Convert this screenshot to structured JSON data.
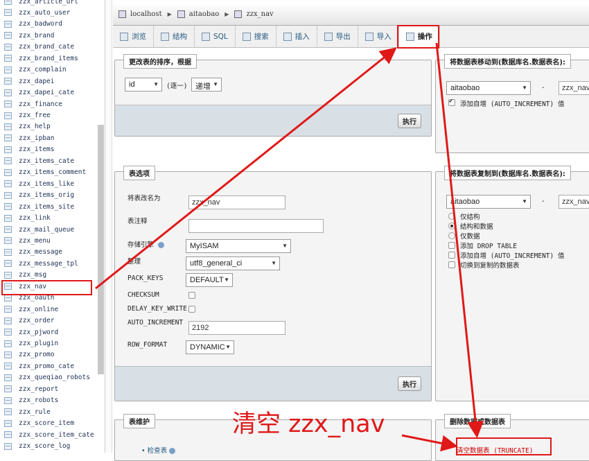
{
  "sidebar": {
    "tables": [
      "zzx_article_url",
      "zzx_auto_user",
      "zzx_badword",
      "zzx_brand",
      "zzx_brand_cate",
      "zzx_brand_items",
      "zzx_complain",
      "zzx_dapei",
      "zzx_dapei_cate",
      "zzx_finance",
      "zzx_free",
      "zzx_help",
      "zzx_ipban",
      "zzx_items",
      "zzx_items_cate",
      "zzx_items_comment",
      "zzx_items_like",
      "zzx_items_orig",
      "zzx_items_site",
      "zzx_link",
      "zzx_mail_queue",
      "zzx_menu",
      "zzx_message",
      "zzx_message_tpl",
      "zzx_msg",
      "zzx_nav",
      "zzx_oauth",
      "zzx_online",
      "zzx_order",
      "zzx_pjword",
      "zzx_plugin",
      "zzx_promo",
      "zzx_promo_cate",
      "zzx_queqiao_robots",
      "zzx_report",
      "zzx_robots",
      "zzx_rule",
      "zzx_score_item",
      "zzx_score_item_cate",
      "zzx_score_log"
    ]
  },
  "breadcrumb": {
    "server": "localhost",
    "database": "aitaobao",
    "table": "zzx_nav"
  },
  "tabs": [
    "浏览",
    "结构",
    "SQL",
    "搜索",
    "插入",
    "导出",
    "导入",
    "操作"
  ],
  "sort": {
    "legend": "更改表的排序，根据",
    "column": "id",
    "mode_label": "(逐一)",
    "order": "递增",
    "go": "执行"
  },
  "move": {
    "legend": "将数据表移动到(数据库名.数据表名):",
    "db": "aitaobao",
    "dash": "-",
    "table": "zzx_nav",
    "autoinc_label": "添加自增 (AUTO_INCREMENT) 值"
  },
  "options": {
    "legend": "表选项",
    "rename_label": "将表改名为",
    "rename_value": "zzx_nav",
    "comment_label": "表注释",
    "engine_label": "存储引擎",
    "engine_value": "MyISAM",
    "collation_label": "整理",
    "collation_value": "utf8_general_ci",
    "pack_keys_label": "PACK_KEYS",
    "pack_keys_value": "DEFAULT",
    "checksum_label": "CHECKSUM",
    "delay_label": "DELAY_KEY_WRITE",
    "autoinc_label": "AUTO_INCREMENT",
    "autoinc_value": "2192",
    "row_format_label": "ROW_FORMAT",
    "row_format_value": "DYNAMIC",
    "go": "执行"
  },
  "copy": {
    "legend": "将数据表复制到(数据库名.数据表名):",
    "db": "aitaobao",
    "dash": "-",
    "table": "zzx_nav",
    "opt_structure": "仅结构",
    "opt_both": "结构和数据",
    "opt_data": "仅数据",
    "drop_label": "添加 DROP TABLE",
    "autoinc_label": "添加自增 (AUTO_INCREMENT) 值",
    "switch_label": "切换到复制的数据表"
  },
  "maintain": {
    "legend": "表维护",
    "check": "检查表"
  },
  "delete": {
    "legend": "删除数据或数据表",
    "truncate": "清空数据表 (TRUNCATE)"
  },
  "annotation": {
    "text": "清空 zzx_nav",
    "color": "#e01818"
  }
}
